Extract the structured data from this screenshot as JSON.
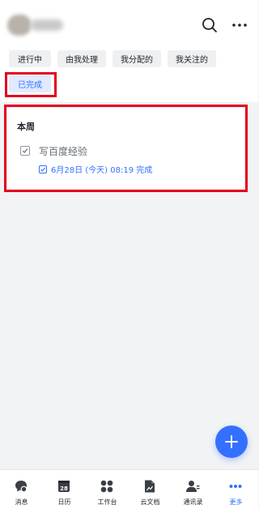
{
  "header": {
    "search_icon": "search-icon",
    "more_icon": "more-icon"
  },
  "tabs": [
    {
      "label": "进行中"
    },
    {
      "label": "由我处理"
    },
    {
      "label": "我分配的"
    },
    {
      "label": "我关注的"
    },
    {
      "label": "已完成",
      "active": true
    }
  ],
  "section": {
    "title": "本周",
    "tasks": [
      {
        "title": "写百度经验",
        "completed": true,
        "meta": "6月28日 (今天) 08:19 完成"
      }
    ]
  },
  "fab": {
    "icon": "plus-icon"
  },
  "bottom_nav": [
    {
      "label": "消息",
      "icon": "chat-icon"
    },
    {
      "label": "日历",
      "icon": "calendar-icon",
      "badge": "28"
    },
    {
      "label": "工作台",
      "icon": "grid-icon"
    },
    {
      "label": "云文档",
      "icon": "document-icon"
    },
    {
      "label": "通讯录",
      "icon": "contacts-icon"
    },
    {
      "label": "更多",
      "icon": "more-icon",
      "active": true
    }
  ],
  "colors": {
    "accent": "#3370ff",
    "highlight": "#e5001c",
    "background": "#f2f3f5"
  }
}
